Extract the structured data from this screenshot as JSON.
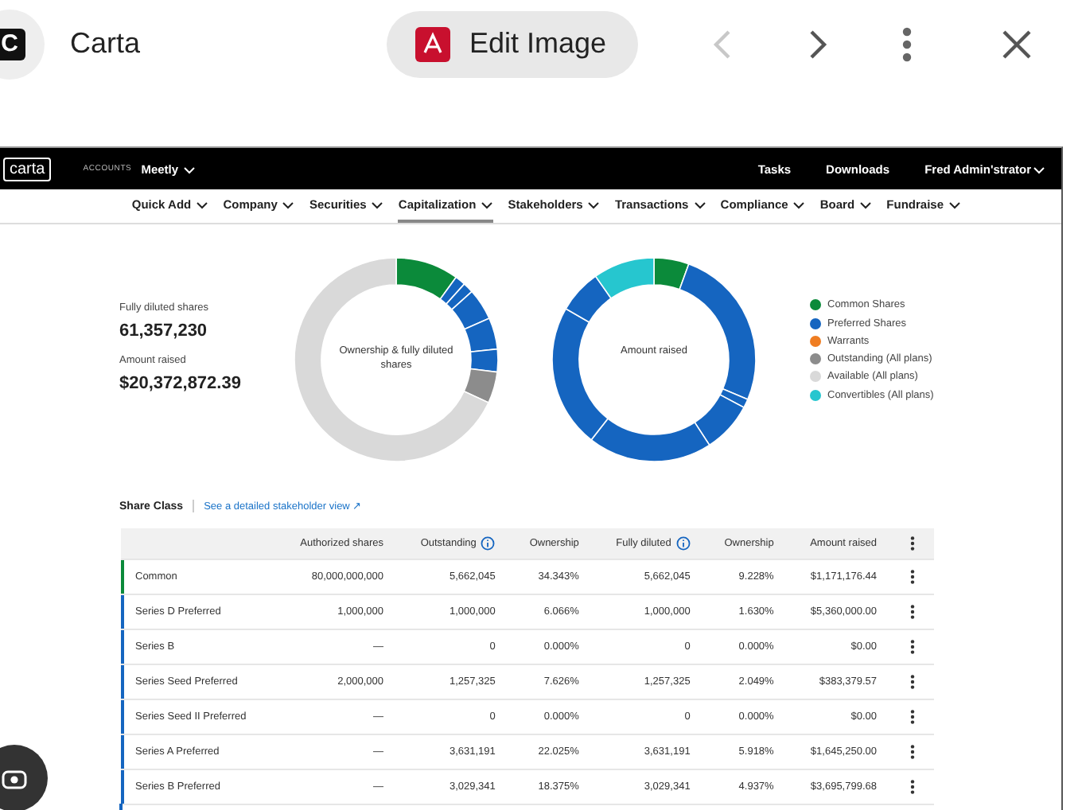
{
  "viewer": {
    "title": "Carta",
    "logo_letter": "C",
    "edit_button": "Edit Image",
    "prev_disabled": true,
    "next_disabled": false
  },
  "app": {
    "logo": "carta",
    "accounts_label": "ACCOUNTS",
    "account": "Meetly",
    "top_links": [
      "Tasks",
      "Downloads",
      "Fred Admin'strator"
    ],
    "nav": [
      {
        "label": "Quick Add",
        "selected": false
      },
      {
        "label": "Company",
        "selected": false
      },
      {
        "label": "Securities",
        "selected": false
      },
      {
        "label": "Capitalization",
        "selected": true
      },
      {
        "label": "Stakeholders",
        "selected": false
      },
      {
        "label": "Transactions",
        "selected": false
      },
      {
        "label": "Compliance",
        "selected": false
      },
      {
        "label": "Board",
        "selected": false
      },
      {
        "label": "Fundraise",
        "selected": false
      }
    ]
  },
  "summary": {
    "fully_diluted_label": "Fully diluted shares",
    "fully_diluted_value": "61,357,230",
    "amount_raised_label": "Amount raised",
    "amount_raised_value": "$20,372,872.39"
  },
  "charts": [
    {
      "center_label": "Ownership & fully diluted shares"
    },
    {
      "center_label": "Amount raised"
    }
  ],
  "legend": [
    {
      "label": "Common Shares",
      "color": "#0b8a3a"
    },
    {
      "label": "Preferred Shares",
      "color": "#1565c0"
    },
    {
      "label": "Warrants",
      "color": "#ef7d22"
    },
    {
      "label": "Outstanding (All plans)",
      "color": "#8c8c8c"
    },
    {
      "label": "Available (All plans)",
      "color": "#d9d9d9"
    },
    {
      "label": "Convertibles (All plans)",
      "color": "#26c6cf"
    }
  ],
  "share_class": {
    "title": "Share Class",
    "link": "See a detailed stakeholder view ↗"
  },
  "table": {
    "columns": [
      {
        "info": false
      },
      {
        "label": "Authorized shares",
        "info": false
      },
      {
        "label": "Outstanding",
        "info": true
      },
      {
        "label": "Ownership",
        "info": false
      },
      {
        "label": "Fully diluted",
        "info": true
      },
      {
        "label": "Ownership",
        "info": false
      },
      {
        "label": "Amount raised",
        "info": false
      }
    ],
    "rows": [
      {
        "color": "#0b8a3a",
        "cells": [
          "Common",
          "80,000,000,000",
          "5,662,045",
          "34.343%",
          "5,662,045",
          "9.228%",
          "$1,171,176.44"
        ]
      },
      {
        "color": "#1565c0",
        "cells": [
          "Series D Preferred",
          "1,000,000",
          "1,000,000",
          "6.066%",
          "1,000,000",
          "1.630%",
          "$5,360,000.00"
        ]
      },
      {
        "color": "#1565c0",
        "cells": [
          "Series B",
          "—",
          "0",
          "0.000%",
          "0",
          "0.000%",
          "$0.00"
        ]
      },
      {
        "color": "#1565c0",
        "cells": [
          "Series Seed Preferred",
          "2,000,000",
          "1,257,325",
          "7.626%",
          "1,257,325",
          "2.049%",
          "$383,379.57"
        ]
      },
      {
        "color": "#1565c0",
        "cells": [
          "Series Seed II Preferred",
          "—",
          "0",
          "0.000%",
          "0",
          "0.000%",
          "$0.00"
        ]
      },
      {
        "color": "#1565c0",
        "cells": [
          "Series A Preferred",
          "—",
          "3,631,191",
          "22.025%",
          "3,631,191",
          "5.918%",
          "$1,645,250.00"
        ]
      },
      {
        "color": "#1565c0",
        "cells": [
          "Series B Preferred",
          "—",
          "3,029,341",
          "18.375%",
          "3,029,341",
          "4.937%",
          "$3,695,799.68"
        ]
      }
    ]
  }
}
